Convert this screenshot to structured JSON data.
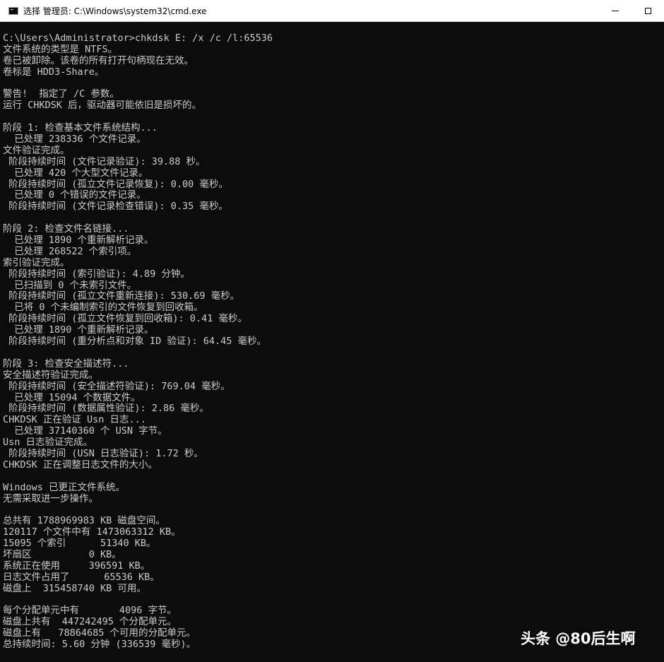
{
  "window": {
    "title": "选择 管理员: C:\\Windows\\system32\\cmd.exe",
    "icon": "console-icon",
    "controls": {
      "minimize": "minimize-icon",
      "maximize": "maximize-icon"
    }
  },
  "console": {
    "lines": [
      "C:\\Users\\Administrator>chkdsk E: /x /c /l:65536",
      "文件系统的类型是 NTFS。",
      "卷已被卸除。该卷的所有打开句柄现在无效。",
      "卷标是 HDD3-Share。",
      "",
      "警告!  指定了 /C 参数。",
      "运行 CHKDSK 后，驱动器可能依旧是损坏的。",
      "",
      "阶段 1: 检查基本文件系统结构...",
      "  已处理 238336 个文件记录。",
      "文件验证完成。",
      " 阶段持续时间 (文件记录验证): 39.88 秒。",
      "  已处理 420 个大型文件记录。",
      " 阶段持续时间 (孤立文件记录恢复): 0.00 毫秒。",
      "  已处理 0 个错误的文件记录。",
      " 阶段持续时间 (文件记录检查错误): 0.35 毫秒。",
      "",
      "阶段 2: 检查文件名链接...",
      "  已处理 1890 个重新解析记录。",
      "  已处理 268522 个索引项。",
      "索引验证完成。",
      " 阶段持续时间 (索引验证): 4.89 分钟。",
      "  已扫描到 0 个未索引文件。",
      " 阶段持续时间 (孤立文件重新连接): 530.69 毫秒。",
      "  已将 0 个未编制索引的文件恢复到回收箱。",
      " 阶段持续时间 (孤立文件恢复到回收箱): 0.41 毫秒。",
      "  已处理 1890 个重新解析记录。",
      " 阶段持续时间 (重分析点和对象 ID 验证): 64.45 毫秒。",
      "",
      "阶段 3: 检查安全描述符...",
      "安全描述符验证完成。",
      " 阶段持续时间 (安全描述符验证): 769.04 毫秒。",
      "  已处理 15094 个数据文件。",
      " 阶段持续时间 (数据属性验证): 2.86 毫秒。",
      "CHKDSK 正在验证 Usn 日志...",
      "  已处理 37140360 个 USN 字节。",
      "Usn 日志验证完成。",
      " 阶段持续时间 (USN 日志验证): 1.72 秒。",
      "CHKDSK 正在调整日志文件的大小。",
      "",
      "Windows 已更正文件系统。",
      "无需采取进一步操作。",
      "",
      "总共有 1788969983 KB 磁盘空间。",
      "120117 个文件中有 1473063312 KB。",
      "15095 个索引      51340 KB。",
      "坏扇区          0 KB。",
      "系统正在使用     396591 KB。",
      "日志文件占用了      65536 KB。",
      "磁盘上  315458740 KB 可用。",
      "",
      "每个分配单元中有       4096 字节。",
      "磁盘上共有  447242495 个分配单元。",
      "磁盘上有   78864685 个可用的分配单元。",
      "总持续时间: 5.60 分钟 (336539 毫秒)。"
    ]
  },
  "watermark": {
    "text": "头条 @80后生啊"
  },
  "colors": {
    "background": "#0c0c0c",
    "text": "#cccccc",
    "titlebar": "#ffffff"
  }
}
